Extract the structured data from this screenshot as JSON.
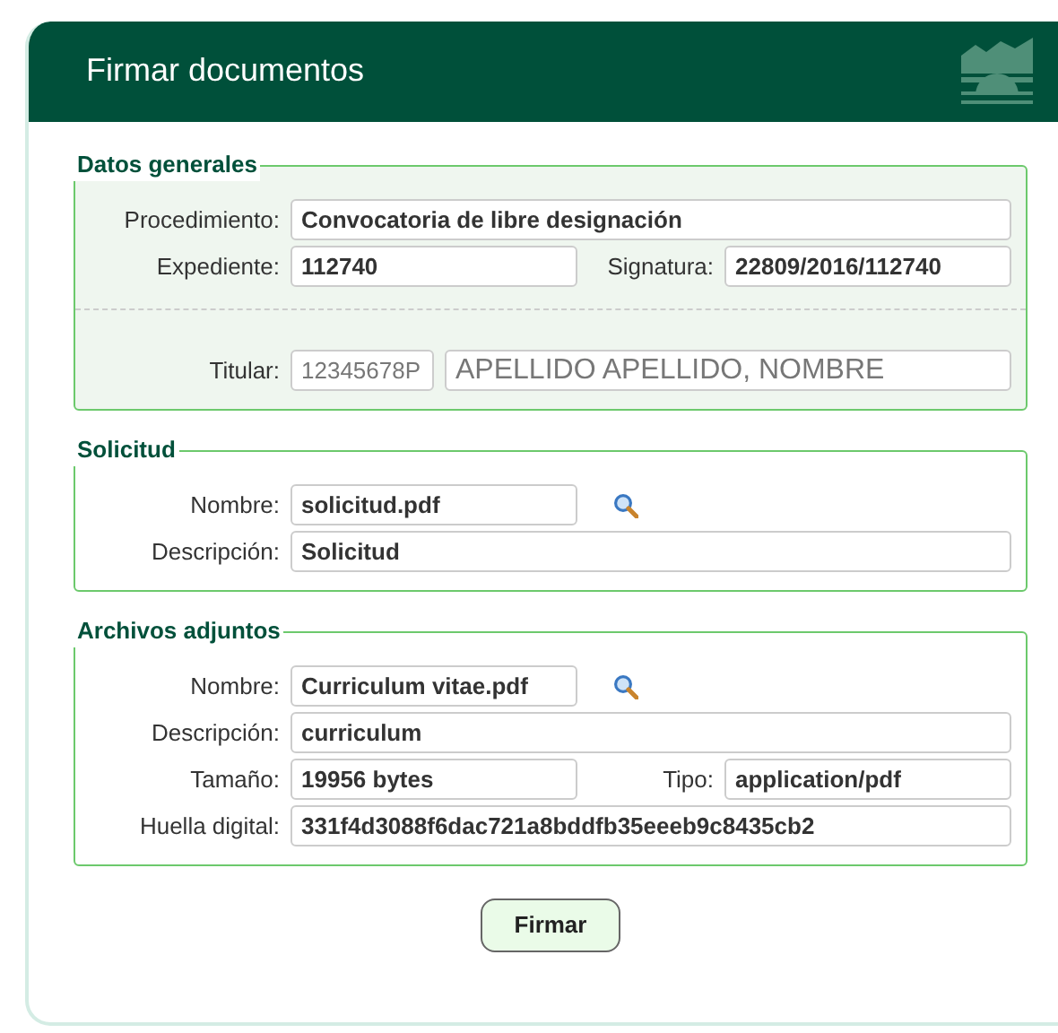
{
  "header": {
    "title": "Firmar documentos"
  },
  "sections": [
    {
      "legend": "Datos generales",
      "rows": [
        {
          "kind": "full",
          "label": "Procedimiento:",
          "value": "Convocatoria de libre designación"
        },
        {
          "kind": "pair",
          "label": "Expediente:",
          "value": "112740",
          "label2": "Signatura:",
          "value2": "22809/2016/112740"
        },
        {
          "kind": "holder",
          "label": "Titular:",
          "value": "12345678P",
          "value2": "APELLIDO APELLIDO, NOMBRE",
          "disabled": true
        }
      ]
    },
    {
      "legend": "Solicitud",
      "rows": [
        {
          "kind": "file",
          "label": "Nombre:",
          "value": "solicitud.pdf"
        },
        {
          "kind": "full",
          "label": "Descripción:",
          "value": "Solicitud"
        }
      ]
    },
    {
      "legend": "Archivos adjuntos",
      "rows": [
        {
          "kind": "file",
          "label": "Nombre:",
          "value": "Curriculum vitae.pdf"
        },
        {
          "kind": "full",
          "label": "Descripción:",
          "value": "curriculum"
        },
        {
          "kind": "pair",
          "label": "Tamaño:",
          "value": "19956  bytes",
          "label2": "Tipo:",
          "value2": "application/pdf"
        },
        {
          "kind": "full",
          "label": "Huella digital:",
          "value": "331f4d3088f6dac721a8bddfb35eeeb9c8435cb2"
        }
      ]
    }
  ],
  "button": "Firmar"
}
